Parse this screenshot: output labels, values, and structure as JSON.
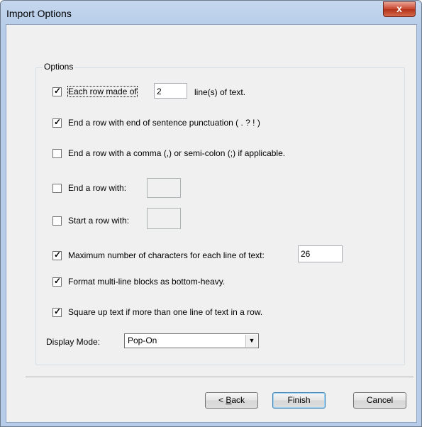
{
  "window": {
    "title": "Import Options",
    "close_glyph": "x"
  },
  "options": {
    "legend": "Options",
    "each_row": {
      "checked": true,
      "label": "Each row made of",
      "value": "2",
      "suffix": "line(s) of text."
    },
    "end_sentence": {
      "checked": true,
      "label": "End a row with end of sentence punctuation   ( . ? ! )"
    },
    "end_comma": {
      "checked": false,
      "label": "End a row with a comma (,) or semi-colon (;) if applicable."
    },
    "end_with": {
      "checked": false,
      "label": "End a row with:",
      "value": ""
    },
    "start_with": {
      "checked": false,
      "label": "Start a row with:",
      "value": ""
    },
    "max_chars": {
      "checked": true,
      "label": "Maximum number of characters for each line of text:",
      "value": "26"
    },
    "bottom_heavy": {
      "checked": true,
      "label": "Format multi-line blocks as bottom-heavy."
    },
    "square_up": {
      "checked": true,
      "label": "Square up text if more than one line of text in a row."
    },
    "display_mode": {
      "label": "Display Mode:",
      "value": "Pop-On"
    }
  },
  "buttons": {
    "back_prefix": "< ",
    "back_key": "B",
    "back_rest": "ack",
    "finish": "Finish",
    "cancel": "Cancel"
  },
  "colors": {
    "close_button": "#c8442c",
    "title_bar": "#c5d7ee"
  }
}
